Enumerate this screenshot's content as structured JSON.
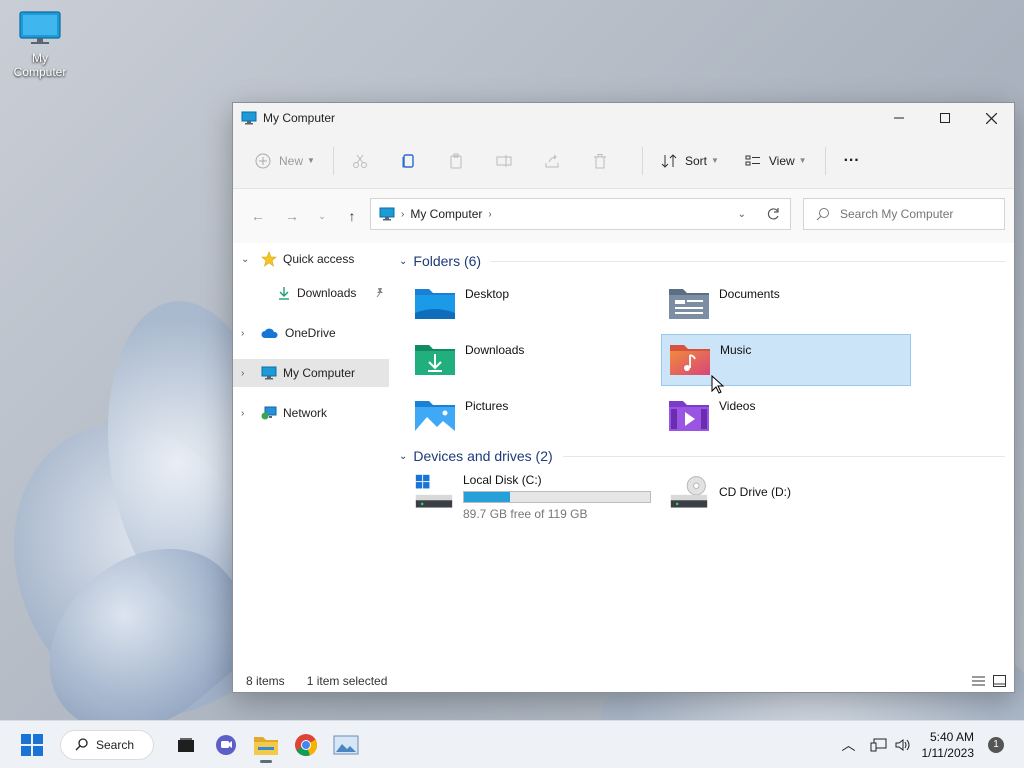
{
  "desktop": {
    "icon_label": "My Computer"
  },
  "window": {
    "title": "My Computer",
    "toolbar": {
      "new_label": "New",
      "sort_label": "Sort",
      "view_label": "View",
      "more_label": "···"
    },
    "address": {
      "crumb": "My Computer"
    },
    "search": {
      "placeholder": "Search My Computer"
    }
  },
  "sidebar": {
    "items": [
      {
        "label": "Quick access"
      },
      {
        "label": "Downloads"
      },
      {
        "label": "OneDrive"
      },
      {
        "label": "My Computer"
      },
      {
        "label": "Network"
      }
    ]
  },
  "folders": {
    "heading": "Folders (6)",
    "items": [
      {
        "name": "Desktop"
      },
      {
        "name": "Documents"
      },
      {
        "name": "Downloads"
      },
      {
        "name": "Music"
      },
      {
        "name": "Pictures"
      },
      {
        "name": "Videos"
      }
    ]
  },
  "drives": {
    "heading": "Devices and drives (2)",
    "items": [
      {
        "name": "Local Disk (C:)",
        "free": "89.7 GB free of 119 GB",
        "used_fraction": 0.246
      },
      {
        "name": "CD Drive (D:)"
      }
    ]
  },
  "status": {
    "count": "8 items",
    "selection": "1 item selected"
  },
  "taskbar": {
    "search_label": "Search",
    "time": "5:40 AM",
    "date": "1/11/2023",
    "notifications": "1"
  },
  "colors": {
    "accent": "#26a0da",
    "selection": "#cce4f7"
  }
}
